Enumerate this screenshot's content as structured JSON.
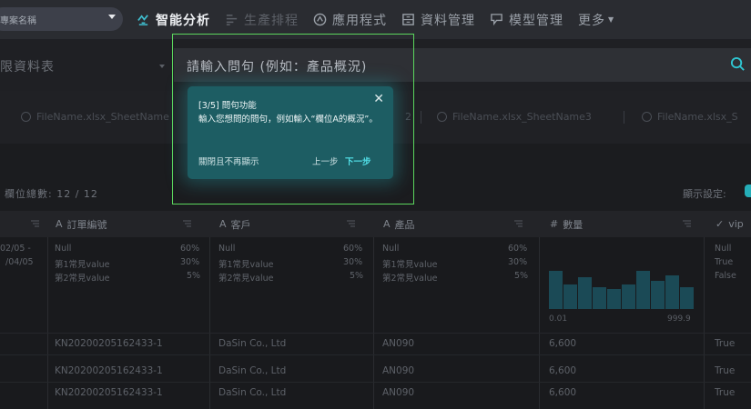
{
  "header": {
    "project_select": "專案名稱",
    "nav": [
      {
        "label": "智能分析",
        "icon": "ai-analysis-icon",
        "state": "active"
      },
      {
        "label": "生產排程",
        "icon": "schedule-icon",
        "state": "dim"
      },
      {
        "label": "應用程式",
        "icon": "app-icon",
        "state": "mid"
      },
      {
        "label": "資料管理",
        "icon": "data-manage-icon",
        "state": "mid"
      },
      {
        "label": "模型管理",
        "icon": "model-icon",
        "state": "mid"
      },
      {
        "label": "更多",
        "icon": "",
        "state": "mid"
      }
    ]
  },
  "toolbar": {
    "permission_select": "限資料表",
    "query_placeholder": "請輸入問句 (例如：產品概況)"
  },
  "sheets": [
    "FileName.xlsx_SheetName",
    "2",
    "FileName.xlsx_SheetName3",
    "FileName.xlsx_S"
  ],
  "summary": {
    "column_count": "欄位總數: 12 / 12",
    "display_setting": "顯示設定:"
  },
  "table": {
    "headers": [
      {
        "type": "",
        "label": ""
      },
      {
        "type": "A",
        "label": "訂單編號"
      },
      {
        "type": "A",
        "label": "客戶"
      },
      {
        "type": "A",
        "label": "產品"
      },
      {
        "type": "#",
        "label": "數量"
      },
      {
        "type": "✓",
        "label": "vip"
      }
    ],
    "date_stats": [
      "02/05 -",
      "/04/05"
    ],
    "text_stats": [
      {
        "label": "Null",
        "pct": "60%"
      },
      {
        "label": "第1常見value",
        "pct": "30%"
      },
      {
        "label": "第2常見value",
        "pct": "5%"
      }
    ],
    "bool_stats": [
      "Null",
      "True",
      "False"
    ],
    "hist": {
      "min": "0.01",
      "max": "999.9",
      "bars": [
        0.95,
        0.62,
        0.8,
        0.55,
        0.5,
        0.62,
        0.95,
        0.7,
        0.85,
        0.55
      ]
    },
    "rows": [
      [
        "KN20200205162433-1",
        "DaSin Co., Ltd",
        "AN090",
        "6,600",
        "True"
      ],
      [
        "KN20200205162433-1",
        "DaSin Co., Ltd",
        "AN090",
        "6,600",
        "True"
      ],
      [
        "KN20200205162433-1",
        "DaSin Co., Ltd",
        "AN090",
        "6,600",
        "True"
      ]
    ]
  },
  "tooltip": {
    "step": "[3/5] 問句功能",
    "body": "輸入您想問的問句，例如輸入“欄位A的概況”。",
    "no_more": "關閉且不再顯示",
    "prev": "上一步",
    "next": "下一步"
  },
  "colors": {
    "accent": "#25aeb8",
    "highlight": "#5bd65d",
    "tooltip_bg": "#1d5d63"
  }
}
